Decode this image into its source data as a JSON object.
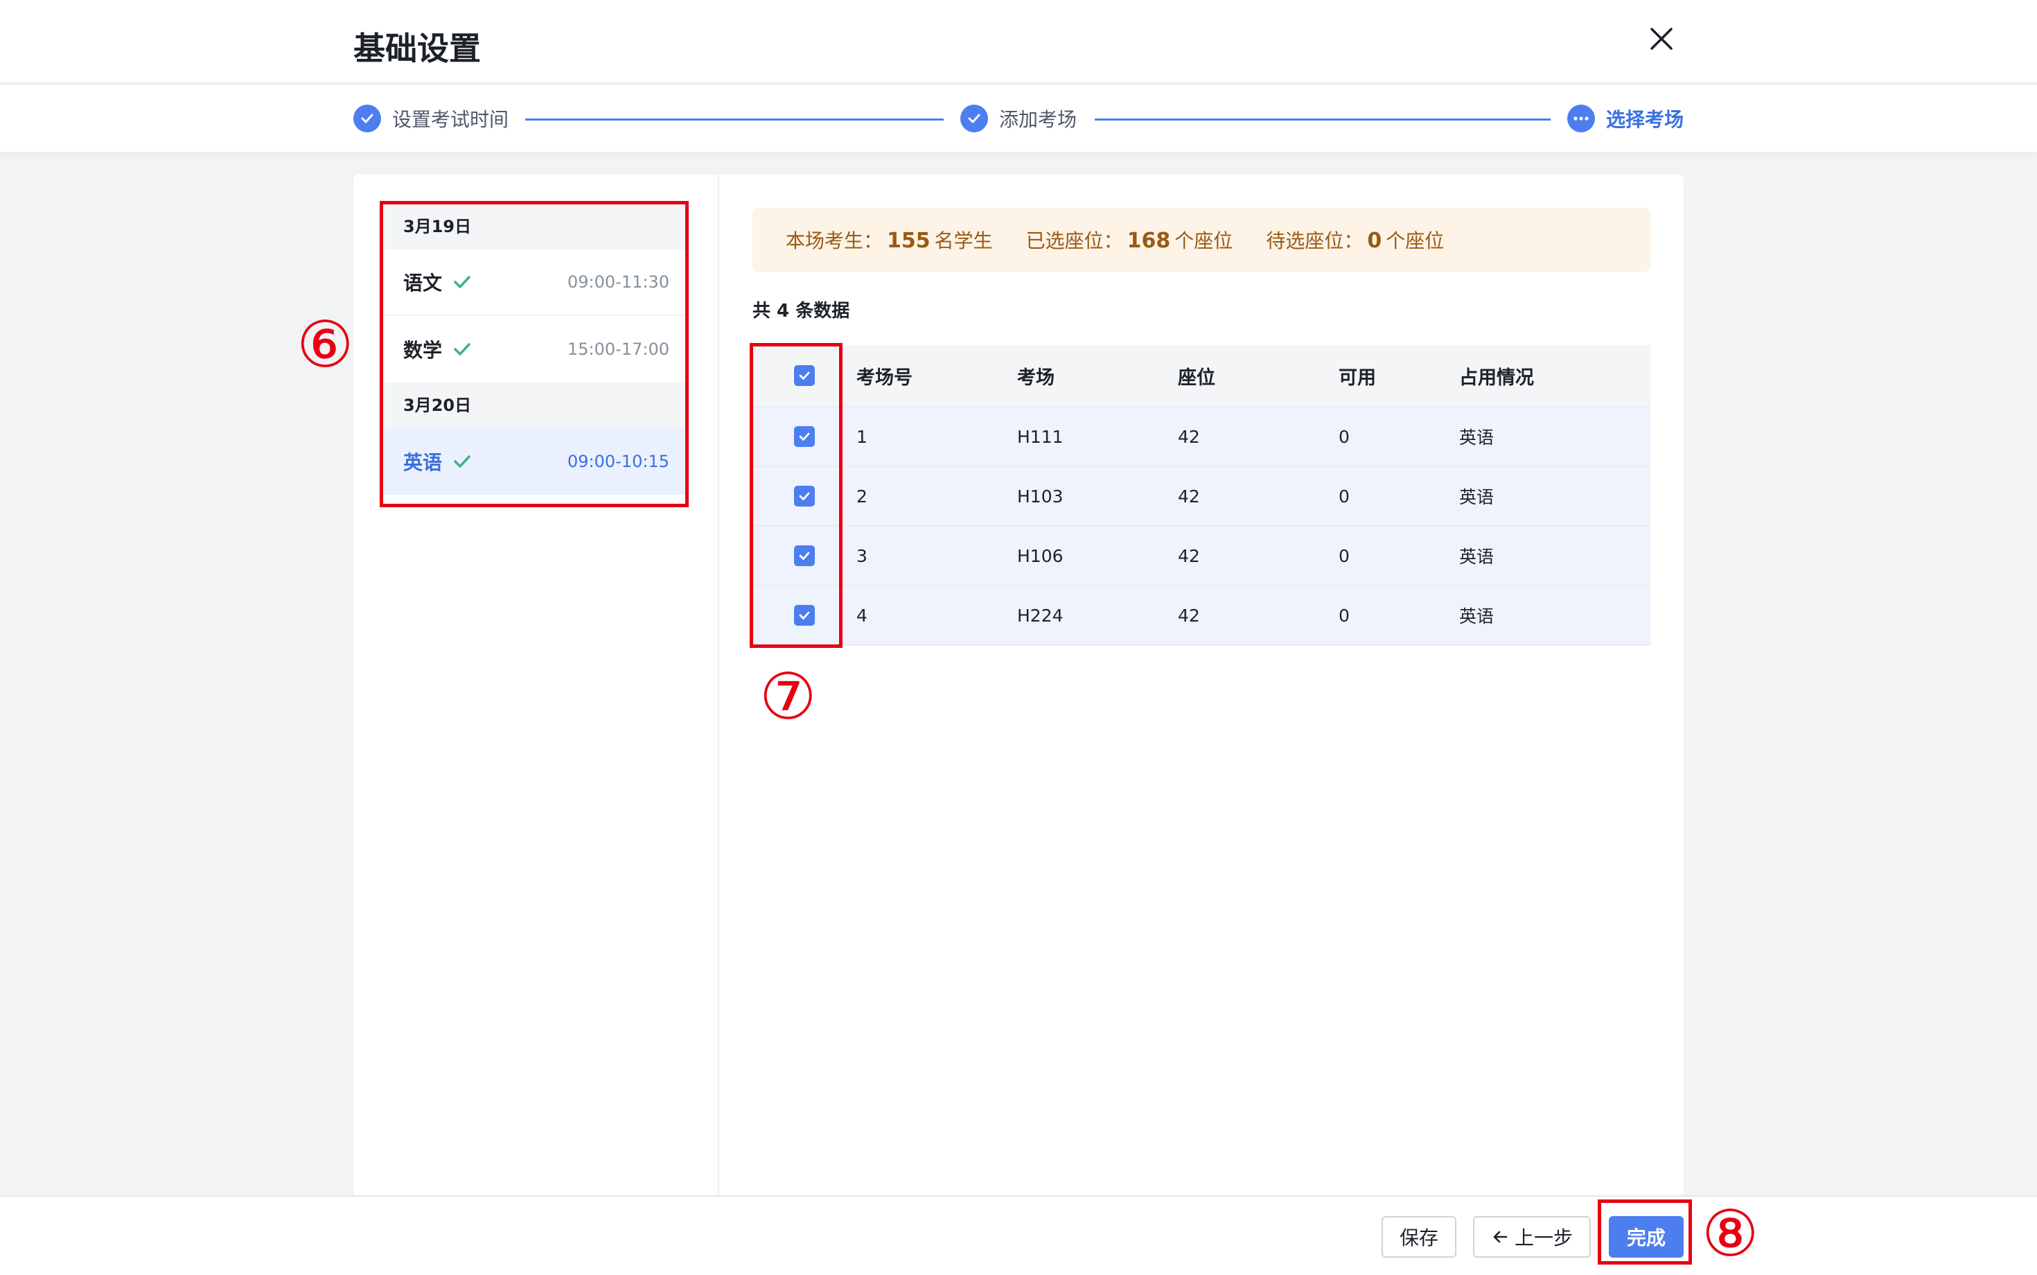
{
  "header": {
    "title": "基础设置"
  },
  "steps": [
    {
      "label": "设置考试时间",
      "state": "done"
    },
    {
      "label": "添加考场",
      "state": "done"
    },
    {
      "label": "选择考场",
      "state": "active"
    }
  ],
  "schedule": {
    "days": [
      {
        "date": "3月19日",
        "subjects": [
          {
            "name": "语文",
            "time": "09:00-11:30",
            "selected": false
          },
          {
            "name": "数学",
            "time": "15:00-17:00",
            "selected": false
          }
        ]
      },
      {
        "date": "3月20日",
        "subjects": [
          {
            "name": "英语",
            "time": "09:00-10:15",
            "selected": true
          }
        ]
      }
    ]
  },
  "notice": {
    "students_label": "本场考生：",
    "students_value": "155",
    "students_unit": "名学生",
    "selected_label": "已选座位：",
    "selected_value": "168",
    "selected_unit": "个座位",
    "pending_label": "待选座位：",
    "pending_value": "0",
    "pending_unit": "个座位"
  },
  "table": {
    "count_text": "共 4 条数据",
    "columns": [
      "考场号",
      "考场",
      "座位",
      "可用",
      "占用情况"
    ],
    "rows": [
      [
        "1",
        "H111",
        "42",
        "0",
        "英语"
      ],
      [
        "2",
        "H103",
        "42",
        "0",
        "英语"
      ],
      [
        "3",
        "H106",
        "42",
        "0",
        "英语"
      ],
      [
        "4",
        "H224",
        "42",
        "0",
        "英语"
      ]
    ]
  },
  "footer": {
    "save_label": "保存",
    "prev_label": "上一步",
    "done_label": "完成"
  },
  "annotations": {
    "m6": "⑥",
    "m7": "⑦",
    "m8": "⑧"
  },
  "colors": {
    "accent": "#4d7ef0",
    "annotation": "#e60012",
    "success": "#3fb27f",
    "notice_bg": "#fdf3e6"
  }
}
